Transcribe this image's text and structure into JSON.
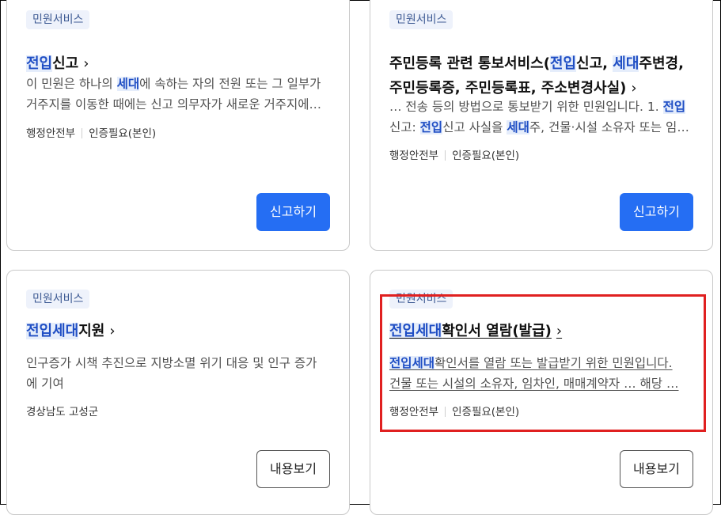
{
  "cards": [
    {
      "tag": "민원서비스",
      "title_parts": [
        [
          "전입",
          true
        ],
        [
          "신고",
          false
        ]
      ],
      "desc_lines": [
        [
          [
            "이 민원은 하나의 ",
            false
          ],
          [
            "세대",
            true
          ],
          [
            "에 속하는 자의 전원 또는 그 일부가",
            false
          ]
        ],
        [
          [
            "거주지를 이동한 때에는 신고 의무자가 새로운 거주지에…",
            false
          ]
        ]
      ],
      "meta": [
        "행정안전부",
        "인증필요(본인)"
      ],
      "button": "신고하기",
      "button_style": "primary"
    },
    {
      "tag": "민원서비스",
      "title_parts": [
        [
          "주민등록 관련 통보서비스(",
          false
        ],
        [
          "전입",
          true
        ],
        [
          "신고, ",
          false
        ],
        [
          "세대",
          true
        ],
        [
          "주변경, 주민등록증, 주민등록표, 주소변경사실)",
          false
        ]
      ],
      "desc_lines": [
        [
          [
            "… 전송 등의 방법으로 통보받기 위한 민원입니다. 1. ",
            false
          ],
          [
            "전입",
            true
          ]
        ],
        [
          [
            "신고: ",
            false
          ],
          [
            "전입",
            true
          ],
          [
            "신고 사실을 ",
            false
          ],
          [
            "세대",
            true
          ],
          [
            "주, 건물·시설 소유자 또는 임…",
            false
          ]
        ]
      ],
      "meta": [
        "행정안전부",
        "인증필요(본인)"
      ],
      "button": "신고하기",
      "button_style": "primary"
    },
    {
      "tag": "민원서비스",
      "title_parts": [
        [
          "전입세대",
          true
        ],
        [
          "지원",
          false
        ]
      ],
      "desc_lines": [
        [
          [
            "인구증가 시책 추진으로 지방소멸 위기 대응 및 인구 증가",
            false
          ]
        ],
        [
          [
            "에 기여",
            false
          ]
        ]
      ],
      "meta": [
        "경상남도 고성군"
      ],
      "button": "내용보기",
      "button_style": "secondary"
    },
    {
      "tag": "민원서비스",
      "title_parts": [
        [
          "전입세대",
          true
        ],
        [
          "확인서 열람(발급)",
          false
        ]
      ],
      "desc_lines": [
        [
          [
            "전입세대",
            true
          ],
          [
            "확인서를 열람 또는 발급받기 위한 민원입니다.",
            false
          ]
        ],
        [
          [
            "건물 또는 시설의 소유자, 임차인, 매매계약자 … 해당 …",
            false
          ]
        ]
      ],
      "meta": [
        "행정안전부",
        "인증필요(본인)"
      ],
      "button": "내용보기",
      "button_style": "secondary"
    }
  ],
  "chevron": "›",
  "colors": {
    "accent": "#256ef3",
    "highlight_text": "#1f4ec4",
    "highlight_bg": "#e5edfb",
    "focus_outline": "#e02020"
  }
}
